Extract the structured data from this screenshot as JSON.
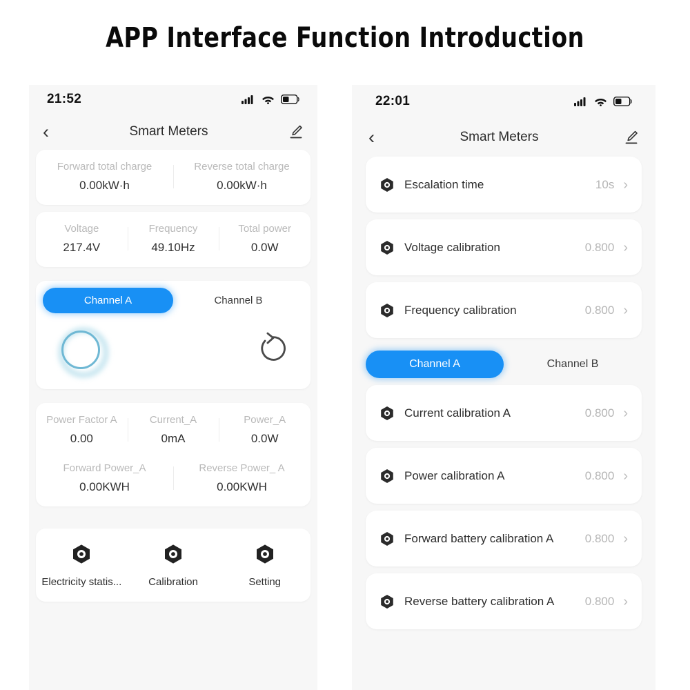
{
  "page": {
    "title": "APP Interface Function Introduction"
  },
  "left_phone": {
    "status": {
      "time": "21:52",
      "signal_icon": "signal-bars-icon",
      "wifi_icon": "wifi-icon",
      "battery_icon": "battery-low-icon"
    },
    "nav": {
      "back_icon": "back-chevron-icon",
      "title": "Smart Meters",
      "edit_icon": "edit-pencil-icon"
    },
    "totals": [
      {
        "label": "Forward total charge",
        "value": "0.00kW·h"
      },
      {
        "label": "Reverse total charge",
        "value": "0.00kW·h"
      }
    ],
    "mains": [
      {
        "label": "Voltage",
        "value": "217.4V"
      },
      {
        "label": "Frequency",
        "value": "49.10Hz"
      },
      {
        "label": "Total power",
        "value": "0.0W"
      }
    ],
    "tabs": [
      {
        "label": "Channel A",
        "active": true
      },
      {
        "label": "Channel B",
        "active": false
      }
    ],
    "spinner": {
      "loader_icon": "loading-ring-icon",
      "refresh_icon": "refresh-ccw-icon"
    },
    "channel_metrics": [
      {
        "label": "Power Factor A",
        "value": "0.00"
      },
      {
        "label": "Current_A",
        "value": "0mA"
      },
      {
        "label": "Power_A",
        "value": "0.0W"
      }
    ],
    "channel_energy": [
      {
        "label": "Forward Power_A",
        "value": "0.00KWH"
      },
      {
        "label": "Reverse Power_ A",
        "value": "0.00KWH"
      }
    ],
    "bottom_nav": [
      {
        "icon": "hex-nut-icon",
        "label": "Electricity statis..."
      },
      {
        "icon": "hex-nut-icon",
        "label": "Calibration"
      },
      {
        "icon": "hex-nut-icon",
        "label": "Setting"
      }
    ]
  },
  "right_phone": {
    "status": {
      "time": "22:01",
      "signal_icon": "signal-bars-icon",
      "wifi_icon": "wifi-icon",
      "battery_icon": "battery-low-icon"
    },
    "nav": {
      "back_icon": "back-chevron-icon",
      "title": "Smart Meters",
      "edit_icon": "edit-pencil-icon"
    },
    "settings_top": [
      {
        "icon": "hex-nut-icon",
        "label": "Escalation time",
        "value": "10s",
        "chevron": "›"
      },
      {
        "icon": "hex-nut-icon",
        "label": "Voltage calibration",
        "value": "0.800",
        "chevron": "›"
      },
      {
        "icon": "hex-nut-icon",
        "label": "Frequency calibration",
        "value": "0.800",
        "chevron": "›"
      }
    ],
    "tabs": [
      {
        "label": "Channel A",
        "active": true
      },
      {
        "label": "Channel B",
        "active": false
      }
    ],
    "settings_channel": [
      {
        "icon": "hex-nut-icon",
        "label": "Current calibration A",
        "value": "0.800",
        "chevron": "›"
      },
      {
        "icon": "hex-nut-icon",
        "label": "Power calibration A",
        "value": "0.800",
        "chevron": "›"
      },
      {
        "icon": "hex-nut-icon",
        "label": "Forward battery calibration A",
        "value": "0.800",
        "chevron": "›"
      },
      {
        "icon": "hex-nut-icon",
        "label": "Reverse battery calibration A",
        "value": "0.800",
        "chevron": "›"
      }
    ]
  },
  "colors": {
    "accent": "#1890f5",
    "ring": "#6fb8d4",
    "muted": "#b9b9b9",
    "text": "#2d2d2d"
  }
}
